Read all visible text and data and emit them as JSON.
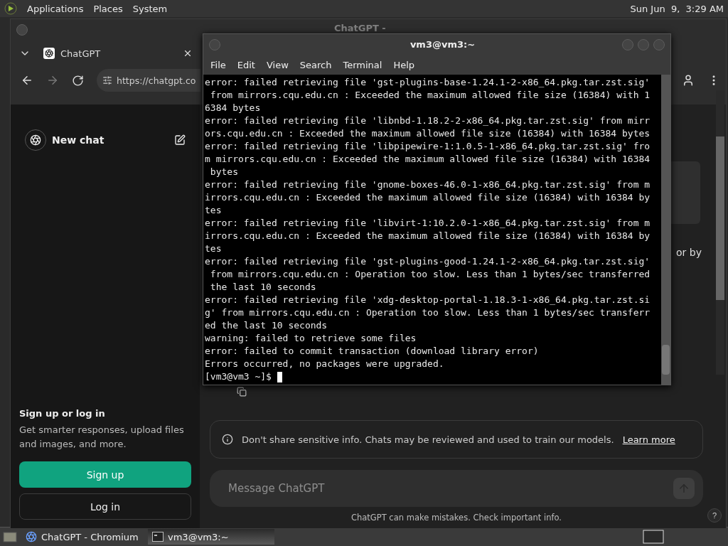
{
  "top_panel": {
    "menus": [
      "Applications",
      "Places",
      "System"
    ],
    "clock": "Sun Jun  9,  3:29 AM"
  },
  "browser": {
    "window_title": "ChatGPT -",
    "tab": {
      "title": "ChatGPT"
    },
    "url": "https://chatgpt.co",
    "sidebar": {
      "new_chat": "New chat",
      "signup_title": "Sign up or log in",
      "signup_text": "Get smarter responses, upload files and images, and more.",
      "signup_button": "Sign up",
      "login_button": "Log in"
    },
    "main": {
      "partial_text": "or by",
      "notice": "Don't share sensitive info. Chats may be reviewed and used to train our models.",
      "notice_link": "Learn more",
      "message_placeholder": "Message ChatGPT",
      "footer": "ChatGPT can make mistakes. Check important info.",
      "help": "?"
    }
  },
  "terminal": {
    "title": "vm3@vm3:~",
    "menus": [
      "File",
      "Edit",
      "View",
      "Search",
      "Terminal",
      "Help"
    ],
    "lines": [
      "error: failed retrieving file 'gst-plugins-base-1.24.1-2-x86_64.pkg.tar.zst.sig'",
      " from mirrors.cqu.edu.cn : Exceeded the maximum allowed file size (16384) with 1",
      "6384 bytes",
      "error: failed retrieving file 'libnbd-1.18.2-2-x86_64.pkg.tar.zst.sig' from mirr",
      "ors.cqu.edu.cn : Exceeded the maximum allowed file size (16384) with 16384 bytes",
      "error: failed retrieving file 'libpipewire-1:1.0.5-1-x86_64.pkg.tar.zst.sig' fro",
      "m mirrors.cqu.edu.cn : Exceeded the maximum allowed file size (16384) with 16384",
      " bytes",
      "error: failed retrieving file 'gnome-boxes-46.0-1-x86_64.pkg.tar.zst.sig' from m",
      "irrors.cqu.edu.cn : Exceeded the maximum allowed file size (16384) with 16384 by",
      "tes",
      "error: failed retrieving file 'libvirt-1:10.2.0-1-x86_64.pkg.tar.zst.sig' from m",
      "irrors.cqu.edu.cn : Exceeded the maximum allowed file size (16384) with 16384 by",
      "tes",
      "error: failed retrieving file 'gst-plugins-good-1.24.1-2-x86_64.pkg.tar.zst.sig'",
      " from mirrors.cqu.edu.cn : Operation too slow. Less than 1 bytes/sec transferred",
      " the last 10 seconds",
      "error: failed retrieving file 'xdg-desktop-portal-1.18.3-1-x86_64.pkg.tar.zst.si",
      "g' from mirrors.cqu.edu.cn : Operation too slow. Less than 1 bytes/sec transferr",
      "ed the last 10 seconds",
      "warning: failed to retrieve some files",
      "error: failed to commit transaction (download library error)",
      "Errors occurred, no packages were upgraded."
    ],
    "prompt": "[vm3@vm3 ~]$"
  },
  "taskbar": {
    "tasks": [
      {
        "label": "ChatGPT - Chromium",
        "kind": "browser",
        "selected": false
      },
      {
        "label": "vm3@vm3:~",
        "kind": "terminal",
        "selected": true
      }
    ]
  }
}
